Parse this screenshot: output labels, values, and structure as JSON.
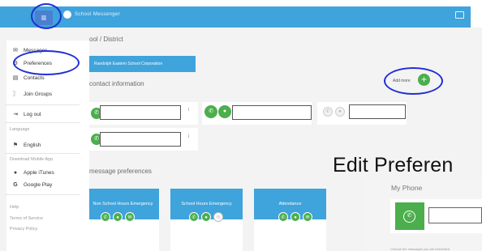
{
  "topbar": {
    "menu_icon": "hamburger-icon",
    "brand": "School Messenger",
    "exit_icon": "sign-out-icon"
  },
  "sidebar": {
    "items": [
      {
        "label": "Messages",
        "icon": "envelope-icon"
      },
      {
        "label": "Preferences",
        "icon": "gear-icon"
      },
      {
        "label": "Contacts",
        "icon": "address-book-icon"
      },
      {
        "label": "Join Groups",
        "icon": "rss-icon"
      },
      {
        "label": "Log out",
        "icon": "sign-out-icon"
      }
    ],
    "language_label": "Language",
    "language_value": "English",
    "download_label": "Download Mobile App",
    "apps": [
      {
        "label": "Apple iTunes",
        "icon": "apple-icon"
      },
      {
        "label": "Google Play",
        "icon": "google-icon"
      }
    ],
    "footer_links": [
      "Help",
      "Terms of Service",
      "Privacy Policy"
    ]
  },
  "content": {
    "district_title": "ool / District",
    "district_name": "Randolph Eastern School Corporation",
    "contact_title": "contact information",
    "add_more": "Add more",
    "info_glyph": "i",
    "message_prefs_title": "message preferences",
    "pref_cards": [
      "Non School Hours Emergency",
      "School Hours Emergency",
      "Attendance"
    ]
  },
  "popup": {
    "title": "Edit Preferen",
    "phone_label": "My Phone",
    "footer": "Choose the messages you are interested"
  },
  "colors": {
    "brand_blue": "#3fa3dc",
    "action_green": "#4cae4c",
    "annotation_circle": "#1f2fd6"
  }
}
